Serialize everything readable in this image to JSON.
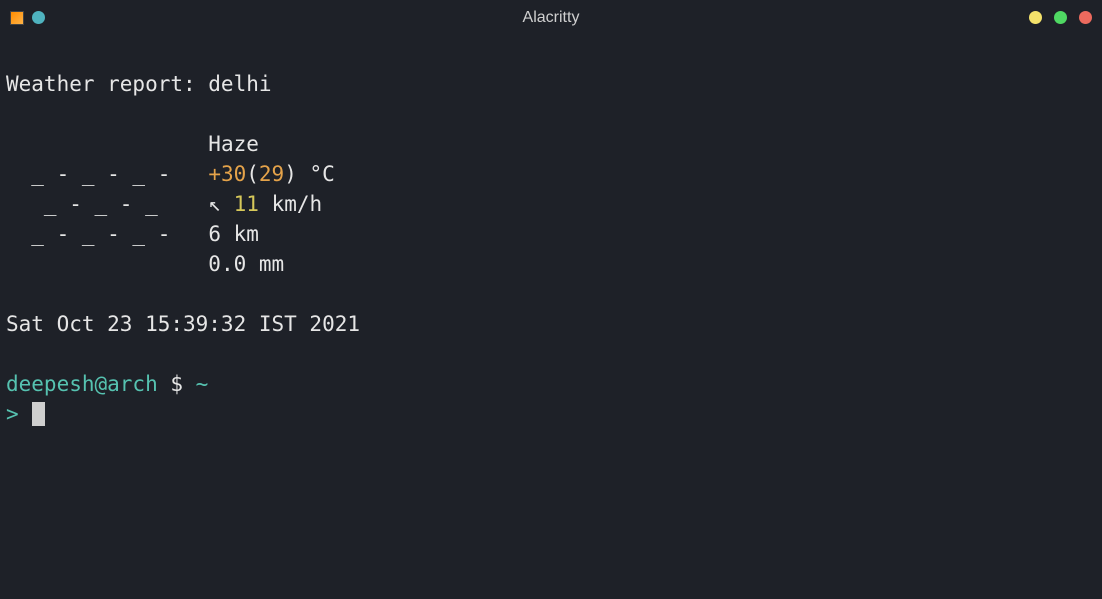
{
  "titlebar": {
    "title": "Alacritty"
  },
  "weather": {
    "header": "Weather report: delhi",
    "condition": "Haze",
    "art_line1": "  _ - _ - _ - ",
    "art_line2": "   _ - _ - _  ",
    "art_line3": "  _ - _ - _ - ",
    "temp_plus": "+30",
    "temp_paren_open": "(",
    "temp_feels": "29",
    "temp_paren_close": ") °C",
    "wind_arrow": "↖",
    "wind_speed": "11",
    "wind_unit": " km/h",
    "visibility": "6 km",
    "precip": "0.0 mm"
  },
  "timestamp": "Sat Oct 23 15:39:32 IST 2021",
  "prompt": {
    "user_host": "deepesh@arch",
    "sep": " $ ",
    "cwd": "~",
    "continuation": ">"
  }
}
